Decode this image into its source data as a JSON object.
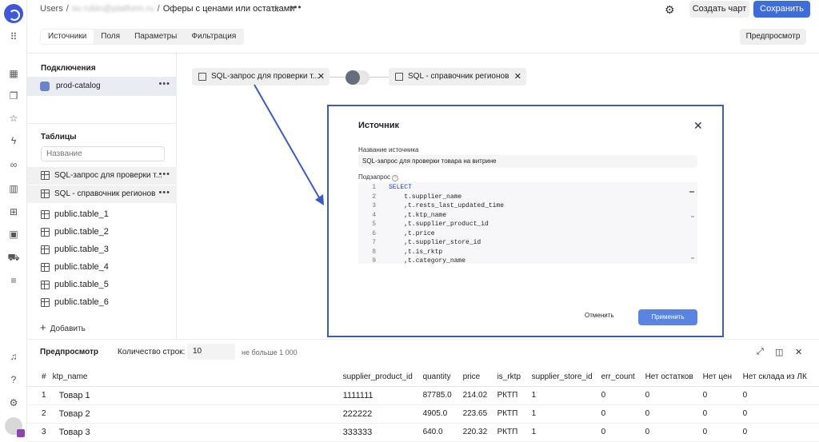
{
  "breadcrumb": {
    "root": "Users",
    "workspace": "so.rubin@platform.ru",
    "title": "Оферы с ценами или остатками"
  },
  "header": {
    "create_chart": "Создать чарт",
    "save": "Сохранить",
    "preview": "Предпросмотр"
  },
  "tabs": [
    "Источники",
    "Поля",
    "Параметры",
    "Фильтрация"
  ],
  "sidebar": {
    "connections_title": "Подключения",
    "connection": "prod-catalog",
    "tables_title": "Таблицы",
    "search_placeholder": "Название",
    "sql_items": [
      "SQL-запрос для проверки т...",
      "SQL - справочник регионов"
    ],
    "tables": [
      "public.table_1",
      "public.table_2",
      "public.table_3",
      "public.table_4",
      "public.table_5",
      "public.table_6"
    ],
    "add_label": "Добавить"
  },
  "canvas": {
    "node_left": "SQL-запрос для проверки т...",
    "node_right": "SQL - справочник регионов"
  },
  "modal": {
    "title": "Источник",
    "name_label": "Название источника",
    "name_value": "SQL-запрос для проверки товара на витрине",
    "query_label": "Подзапрос",
    "code_lines": [
      "SELECT",
      "    t.supplier_name",
      "    ,t.rests_last_updated_time",
      "    ,t.ktp_name",
      "    ,t.supplier_product_id",
      "    ,t.price",
      "    ,t.supplier_store_id",
      "    ,t.is_rktp",
      "    ,t.category_name"
    ],
    "line_numbers": [
      "1",
      "2",
      "3",
      "4",
      "5",
      "6",
      "7",
      "8",
      "9"
    ],
    "cancel": "Отменить",
    "apply": "Применить"
  },
  "preview": {
    "title": "Предпросмотр",
    "rows_label": "Количество строк:",
    "rows_value": "10",
    "rows_note": "не больше 1 000",
    "columns": [
      "#",
      "ktp_name",
      "supplier_product_id",
      "quantity",
      "price",
      "is_rktp",
      "supplier_store_id",
      "err_count",
      "Нет остатков",
      "Нет цен",
      "Нет склада из ЛК"
    ],
    "rows": [
      [
        "1",
        "Товар 1",
        "1111111",
        "87785.0",
        "214.02",
        "РКТП",
        "1",
        "0",
        "0",
        "0",
        "0"
      ],
      [
        "2",
        "Товар 2",
        "222222",
        "4905.0",
        "223.65",
        "РКТП",
        "1",
        "0",
        "0",
        "0",
        "0"
      ],
      [
        "3",
        "Товар 3",
        "333333",
        "640.0",
        "220.32",
        "РКТП",
        "1",
        "0",
        "0",
        "0",
        "0"
      ]
    ]
  },
  "colors": {
    "accent": "#3e6cd8",
    "modal_border": "#3b5bbd",
    "apply": "#5b83e0"
  }
}
